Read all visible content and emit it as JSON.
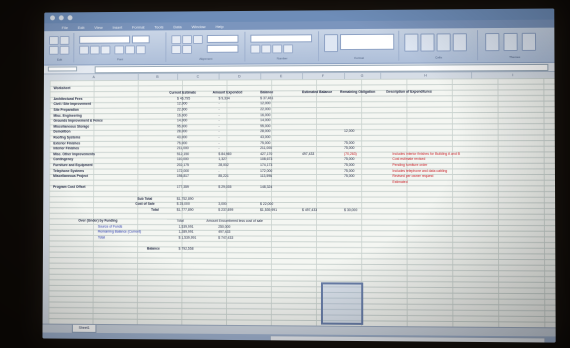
{
  "window": {
    "title": ""
  },
  "menu": [
    "File",
    "Edit",
    "View",
    "Insert",
    "Format",
    "Tools",
    "Data",
    "Window",
    "Help"
  ],
  "ribbon_groups": [
    "Edit",
    "Font",
    "Alignment",
    "Number",
    "Format",
    "Cells",
    "Themes"
  ],
  "formula_bar": {
    "name_box": ""
  },
  "columns": [
    "A",
    "B",
    "C",
    "D",
    "E",
    "F",
    "G",
    "H",
    "I"
  ],
  "sheet": {
    "title": "Worksheet",
    "headers": [
      "Current Estimate",
      "Amount Expended",
      "Balance",
      "Estimated Balance",
      "Remaining Obligation",
      "Description of Expenditures"
    ],
    "rows": [
      {
        "label": "Architectural Fees",
        "c": "$ 46,795",
        "d": "$ 9,334",
        "e": "$ 37,461"
      },
      {
        "label": "Civil / Site Improvement",
        "c": "12,000",
        "d": "-",
        "e": "12,000"
      },
      {
        "label": "Site Preparation",
        "c": "22,000",
        "d": "-",
        "e": "22,000"
      },
      {
        "label": "Misc. Engineering",
        "c": "16,000",
        "d": "-",
        "e": "16,000"
      },
      {
        "label": "Grounds Improvement & Fence",
        "c": "14,000",
        "d": "-",
        "e": "14,000"
      },
      {
        "label": "Miscellaneous Storage",
        "c": "95,000",
        "d": "-",
        "e": "95,000"
      },
      {
        "label": "Demolition",
        "c": "28,000",
        "d": "-",
        "e": "28,000",
        "g": "12,000"
      },
      {
        "label": "Roofing Systems",
        "c": "43,000",
        "d": "-",
        "e": "43,000"
      },
      {
        "label": "Exterior Finishes",
        "c": "75,000",
        "d": "-",
        "e": "75,000",
        "g": "75,000"
      },
      {
        "label": "Interior Finishes",
        "c": "211,000",
        "d": "-",
        "e": "211,000",
        "g": "75,000"
      },
      {
        "label": "Misc. Other Improvements",
        "c": "512,150",
        "d": "$ 84,980",
        "e": "427,170",
        "f": "497,433",
        "g": "(70,263)",
        "red": true
      },
      {
        "label": "Contingency",
        "c": "110,000",
        "d": "1,327",
        "e": "108,673",
        "g": "75,000"
      },
      {
        "label": "Furniture and Equipment",
        "c": "202,175",
        "d": "28,002",
        "e": "174,173",
        "g": "75,000"
      },
      {
        "label": "Telephone Systems",
        "c": "172,000",
        "d": "-",
        "e": "172,000",
        "g": "75,000"
      },
      {
        "label": "Miscellaneous Project",
        "c": "198,817",
        "d": "85,221",
        "e": "113,596",
        "g": "75,000"
      },
      {
        "label": "",
        "c": "",
        "d": "",
        "e": ""
      },
      {
        "label": "Program Cost Offset",
        "c": "177,359",
        "d": "$ 29,035",
        "e": "148,324"
      }
    ],
    "notes": [
      "Includes interior finishes for Building A and B",
      "Cost estimate revised",
      "Pending furniture order",
      "Includes telephone and data cabling",
      "Revised per owner request",
      "Estimated"
    ],
    "subtotal_label": "Sub Total",
    "subtotal_value": "$1,752,890",
    "cost_label": "Cost of Sale",
    "cost_values": [
      "$ 25,000",
      "3,000",
      "$ 22,000"
    ],
    "total_label": "Total",
    "total_values": [
      "$1,777,890",
      "$ 237,899",
      "$1,539,991",
      "$ 497,433",
      "$ 30,000"
    ],
    "summary": {
      "title": "Over (Under) by Funding",
      "col1": "Total",
      "col2": "Amount Encumbered less cost of sale",
      "rows": [
        {
          "label": "Source of Funds",
          "v1": "1,539,991",
          "v2": "250,000"
        },
        {
          "label": "Remaining Balance (Current)",
          "v1": "1,289,991",
          "v2": "497,433"
        },
        {
          "label": "Total",
          "v1": "$ 1,539,991",
          "v2": "$ 747,433"
        }
      ],
      "balance_label": "Balance",
      "balance_value": "$ 792,558"
    }
  },
  "sheet_tab": "Sheet1",
  "colors": {
    "ribbon": "#aebfd9",
    "title": "#6e8db8",
    "negative": "#c81d25"
  }
}
